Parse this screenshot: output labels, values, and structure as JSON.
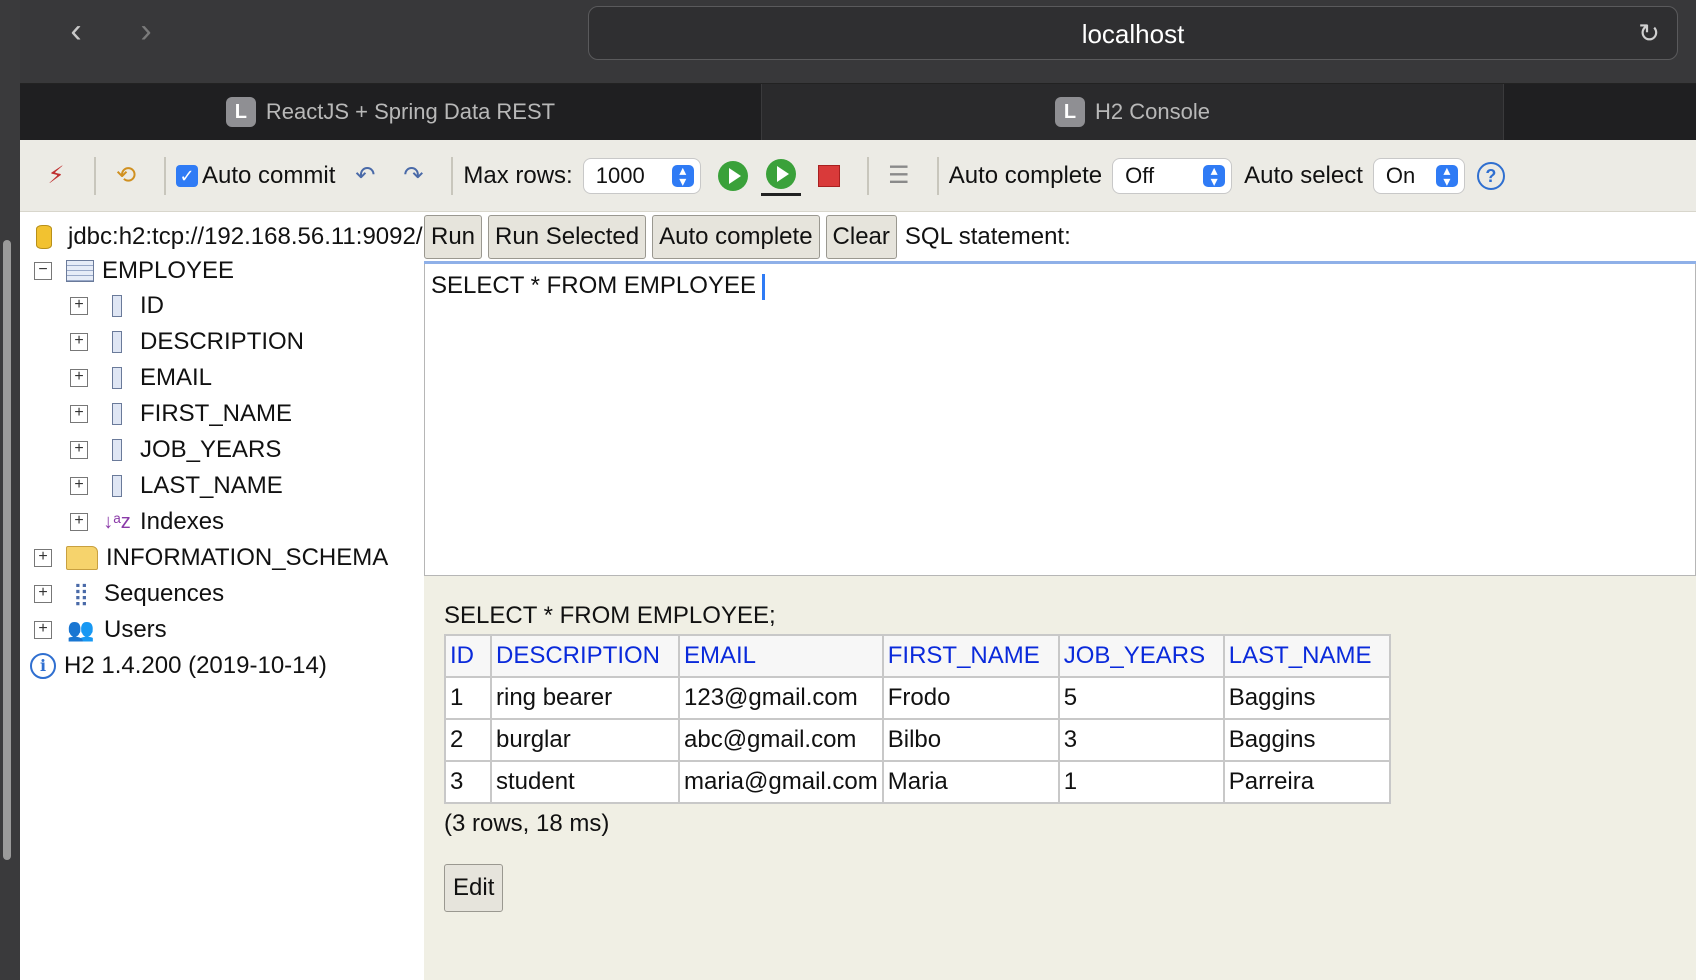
{
  "browser": {
    "url": "localhost",
    "tabs": [
      {
        "favicon": "L",
        "label": "ReactJS + Spring Data REST"
      },
      {
        "favicon": "L",
        "label": "H2 Console"
      }
    ]
  },
  "toolbar": {
    "auto_commit_label": "Auto commit",
    "max_rows_label": "Max rows:",
    "max_rows_value": "1000",
    "auto_complete_label": "Auto complete",
    "auto_complete_value": "Off",
    "auto_select_label": "Auto select",
    "auto_select_value": "On"
  },
  "tree": {
    "connection": "jdbc:h2:tcp://192.168.56.11:9092/",
    "table": "EMPLOYEE",
    "columns": [
      "ID",
      "DESCRIPTION",
      "EMAIL",
      "FIRST_NAME",
      "JOB_YEARS",
      "LAST_NAME"
    ],
    "indexes": "Indexes",
    "information_schema": "INFORMATION_SCHEMA",
    "sequences": "Sequences",
    "users": "Users",
    "version": "H2 1.4.200 (2019-10-14)"
  },
  "sql": {
    "run": "Run",
    "run_selected": "Run Selected",
    "auto_complete": "Auto complete",
    "clear": "Clear",
    "statement_label": "SQL statement:",
    "editor_text": "SELECT * FROM EMPLOYEE"
  },
  "results": {
    "query": "SELECT * FROM EMPLOYEE;",
    "headers": [
      "ID",
      "DESCRIPTION",
      "EMAIL",
      "FIRST_NAME",
      "JOB_YEARS",
      "LAST_NAME"
    ],
    "rows": [
      [
        "1",
        "ring bearer",
        "123@gmail.com",
        "Frodo",
        "5",
        "Baggins"
      ],
      [
        "2",
        "burglar",
        "abc@gmail.com",
        "Bilbo",
        "3",
        "Baggins"
      ],
      [
        "3",
        "student",
        "maria@gmail.com",
        "Maria",
        "1",
        "Parreira"
      ]
    ],
    "summary": "(3 rows, 18 ms)",
    "edit": "Edit"
  }
}
